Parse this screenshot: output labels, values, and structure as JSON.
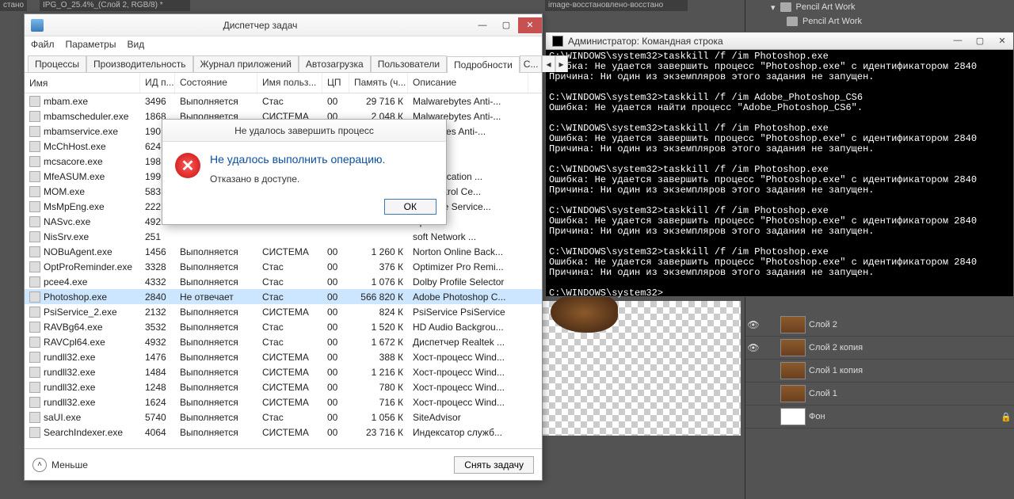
{
  "ps": {
    "tab_left": "стано",
    "tab_mid": "IPG_O_25.4%_(Слой 2, RGB/8) *",
    "tab_right": "image-восстановлено-восстано",
    "tree_items": [
      "Pencil Art Work",
      "Pencil Art Work"
    ],
    "layers": [
      {
        "eye": true,
        "name": "Слой 2",
        "lock": false
      },
      {
        "eye": true,
        "name": "Слой 2 копия",
        "lock": false
      },
      {
        "eye": false,
        "name": "Слой 1 копия",
        "lock": false
      },
      {
        "eye": false,
        "name": "Слой 1",
        "lock": false
      },
      {
        "eye": false,
        "name": "Фон",
        "lock": true,
        "bg": true
      }
    ]
  },
  "console": {
    "title": "Администратор: Командная строка",
    "lines": "C:\\WINDOWS\\system32>taskkill /f /im Photoshop.exe\nОшибка: Не удается завершить процесс \"Photoshop.exe\" с идентификатором 2840\nПричина: Ни один из экземпляров этого задания не запущен.\n\nC:\\WINDOWS\\system32>taskkill /f /im Adobe_Photoshop_CS6\nОшибка: Не удается найти процесс \"Adobe_Photoshop_CS6\".\n\nC:\\WINDOWS\\system32>taskkill /f /im Photoshop.exe\nОшибка: Не удается завершить процесс \"Photoshop.exe\" с идентификатором 2840\nПричина: Ни один из экземпляров этого задания не запущен.\n\nC:\\WINDOWS\\system32>taskkill /f /im Photoshop.exe\nОшибка: Не удается завершить процесс \"Photoshop.exe\" с идентификатором 2840\nПричина: Ни один из экземпляров этого задания не запущен.\n\nC:\\WINDOWS\\system32>taskkill /f /im Photoshop.exe\nОшибка: Не удается завершить процесс \"Photoshop.exe\" с идентификатором 2840\nПричина: Ни один из экземпляров этого задания не запущен.\n\nC:\\WINDOWS\\system32>taskkill /f /im Photoshop.exe\nОшибка: Не удается завершить процесс \"Photoshop.exe\" с идентификатором 2840\nПричина: Ни один из экземпляров этого задания не запущен.\n\nC:\\WINDOWS\\system32>"
  },
  "taskmgr": {
    "title": "Диспетчер задач",
    "menu": [
      "Файл",
      "Параметры",
      "Вид"
    ],
    "tabs": [
      "Процессы",
      "Производительность",
      "Журнал приложений",
      "Автозагрузка",
      "Пользователи",
      "Подробности",
      "С..."
    ],
    "active_tab": 5,
    "columns": [
      "Имя",
      "ИД п...",
      "Состояние",
      "Имя польз...",
      "ЦП",
      "Память (ч...",
      "Описание"
    ],
    "less_label": "Меньше",
    "end_task": "Снять задачу",
    "rows": [
      {
        "name": "mbam.exe",
        "pid": "3496",
        "state": "Выполняется",
        "user": "Стас",
        "cpu": "00",
        "mem": "29 716 К",
        "desc": "Malwarebytes Anti-..."
      },
      {
        "name": "mbamscheduler.exe",
        "pid": "1868",
        "state": "Выполняется",
        "user": "СИСТЕМА",
        "cpu": "00",
        "mem": "2 048 К",
        "desc": "Malwarebytes Anti-..."
      },
      {
        "name": "mbamservice.exe",
        "pid": "190",
        "state": "",
        "user": "",
        "cpu": "",
        "mem": "",
        "desc": "warebytes Anti-..."
      },
      {
        "name": "McChHost.exe",
        "pid": "624",
        "state": "",
        "user": "",
        "cpu": "",
        "mem": "",
        "desc": "dvisor"
      },
      {
        "name": "mcsacore.exe",
        "pid": "198",
        "state": "",
        "user": "",
        "cpu": "",
        "mem": "",
        "desc": "dvisor"
      },
      {
        "name": "MfeASUM.exe",
        "pid": "199",
        "state": "",
        "user": "",
        "cpu": "",
        "mem": "",
        "desc": "ee Application ..."
      },
      {
        "name": "MOM.exe",
        "pid": "583",
        "state": "",
        "user": "",
        "cpu": "",
        "mem": "",
        "desc": "yst Control Ce..."
      },
      {
        "name": "MsMpEng.exe",
        "pid": "222",
        "state": "",
        "user": "",
        "cpu": "",
        "mem": "",
        "desc": "malware Service..."
      },
      {
        "name": "NASvc.exe",
        "pid": "492",
        "state": "",
        "user": "",
        "cpu": "",
        "mem": "",
        "desc": "Update"
      },
      {
        "name": "NisSrv.exe",
        "pid": "251",
        "state": "",
        "user": "",
        "cpu": "",
        "mem": "",
        "desc": "soft Network ..."
      },
      {
        "name": "NOBuAgent.exe",
        "pid": "1456",
        "state": "Выполняется",
        "user": "СИСТЕМА",
        "cpu": "00",
        "mem": "1 260 К",
        "desc": "Norton Online Back..."
      },
      {
        "name": "OptProReminder.exe",
        "pid": "3328",
        "state": "Выполняется",
        "user": "Стас",
        "cpu": "00",
        "mem": "376 К",
        "desc": "Optimizer Pro Remi..."
      },
      {
        "name": "pcee4.exe",
        "pid": "4332",
        "state": "Выполняется",
        "user": "Стас",
        "cpu": "00",
        "mem": "1 076 К",
        "desc": "Dolby Profile Selector"
      },
      {
        "name": "Photoshop.exe",
        "pid": "2840",
        "state": "Не отвечает",
        "user": "Стас",
        "cpu": "00",
        "mem": "566 820 К",
        "desc": "Adobe Photoshop C...",
        "sel": true
      },
      {
        "name": "PsiService_2.exe",
        "pid": "2132",
        "state": "Выполняется",
        "user": "СИСТЕМА",
        "cpu": "00",
        "mem": "824 К",
        "desc": "PsiService PsiService"
      },
      {
        "name": "RAVBg64.exe",
        "pid": "3532",
        "state": "Выполняется",
        "user": "Стас",
        "cpu": "00",
        "mem": "1 520 К",
        "desc": "HD Audio Backgrou..."
      },
      {
        "name": "RAVCpl64.exe",
        "pid": "4932",
        "state": "Выполняется",
        "user": "Стас",
        "cpu": "00",
        "mem": "1 672 К",
        "desc": "Диспетчер Realtek ..."
      },
      {
        "name": "rundll32.exe",
        "pid": "1476",
        "state": "Выполняется",
        "user": "СИСТЕМА",
        "cpu": "00",
        "mem": "388 К",
        "desc": "Хост-процесс Wind..."
      },
      {
        "name": "rundll32.exe",
        "pid": "1484",
        "state": "Выполняется",
        "user": "СИСТЕМА",
        "cpu": "00",
        "mem": "1 216 К",
        "desc": "Хост-процесс Wind..."
      },
      {
        "name": "rundll32.exe",
        "pid": "1248",
        "state": "Выполняется",
        "user": "СИСТЕМА",
        "cpu": "00",
        "mem": "780 К",
        "desc": "Хост-процесс Wind..."
      },
      {
        "name": "rundll32.exe",
        "pid": "1624",
        "state": "Выполняется",
        "user": "СИСТЕМА",
        "cpu": "00",
        "mem": "716 К",
        "desc": "Хост-процесс Wind..."
      },
      {
        "name": "saUI.exe",
        "pid": "5740",
        "state": "Выполняется",
        "user": "Стас",
        "cpu": "00",
        "mem": "1 056 К",
        "desc": "SiteAdvisor"
      },
      {
        "name": "SearchIndexer.exe",
        "pid": "4064",
        "state": "Выполняется",
        "user": "СИСТЕМА",
        "cpu": "00",
        "mem": "23 716 К",
        "desc": "Индексатор служб..."
      }
    ]
  },
  "dialog": {
    "title": "Не удалось завершить процесс",
    "msg1": "Не удалось выполнить операцию.",
    "msg2": "Отказано в доступе.",
    "ok": "ОК"
  }
}
